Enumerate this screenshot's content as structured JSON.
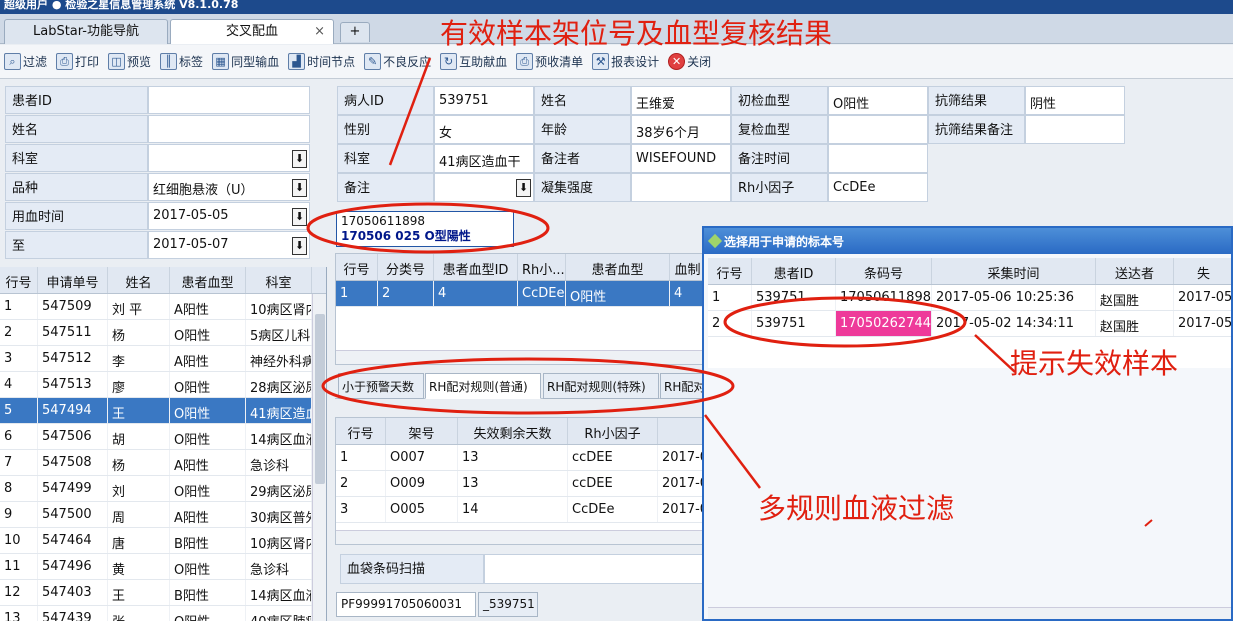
{
  "window": {
    "title": "超级用户  ●  检验之星信息管理系统  V8.1.0.78"
  },
  "tabs": [
    {
      "label": "LabStar-功能导航",
      "close": ""
    },
    {
      "label": "交叉配血",
      "close": "×"
    }
  ],
  "toolbar": [
    {
      "label": "过滤",
      "icon": "filter-icon"
    },
    {
      "label": "打印",
      "icon": "printer-icon"
    },
    {
      "label": "预览",
      "icon": "preview-icon"
    },
    {
      "label": "标签",
      "icon": "barcode-icon"
    },
    {
      "label": "同型输血",
      "icon": "grid-icon"
    },
    {
      "label": "时间节点",
      "icon": "chart-icon"
    },
    {
      "label": "不良反应",
      "icon": "edit-icon"
    },
    {
      "label": "互助献血",
      "icon": "refresh-icon"
    },
    {
      "label": "预收清单",
      "icon": "printer-icon"
    },
    {
      "label": "报表设计",
      "icon": "tools-icon"
    },
    {
      "label": "关闭",
      "icon": "close-icon"
    }
  ],
  "filter_form": [
    {
      "label": "患者ID",
      "value": ""
    },
    {
      "label": "姓名",
      "value": ""
    },
    {
      "label": "科室",
      "value": ""
    },
    {
      "label": "品种",
      "value": "红细胞悬液（U）"
    },
    {
      "label": "用血时间",
      "value": "2017-05-05"
    },
    {
      "label": "至",
      "value": "2017-05-07"
    }
  ],
  "left_grid": {
    "columns": [
      "行号",
      "申请单号",
      "姓名",
      "患者血型",
      "科室"
    ],
    "rows": [
      [
        "1",
        "547509",
        "刘  平",
        "A阳性",
        "10病区肾内"
      ],
      [
        "2",
        "547511",
        "杨",
        "O阳性",
        "5病区儿科"
      ],
      [
        "3",
        "547512",
        "李",
        "A阳性",
        "神经外科病"
      ],
      [
        "4",
        "547513",
        "廖",
        "O阳性",
        "28病区泌尿"
      ],
      [
        "5",
        "547494",
        "王",
        "O阳性",
        "41病区造血"
      ],
      [
        "6",
        "547506",
        "胡",
        "O阳性",
        "14病区血液"
      ],
      [
        "7",
        "547508",
        "杨",
        "A阳性",
        "急诊科"
      ],
      [
        "8",
        "547499",
        "刘",
        "O阳性",
        "29病区泌尿"
      ],
      [
        "9",
        "547500",
        "周",
        "A阳性",
        "30病区普外"
      ],
      [
        "10",
        "547464",
        "唐",
        "B阳性",
        "10病区肾内"
      ],
      [
        "11",
        "547496",
        "黄",
        "O阳性",
        "急诊科"
      ],
      [
        "12",
        "547403",
        "王",
        "B阳性",
        "14病区血液"
      ],
      [
        "13",
        "547439",
        "张",
        "O阳性",
        "40病区肺癌"
      ]
    ]
  },
  "patient": {
    "row1": [
      [
        "病人ID",
        "539751"
      ],
      [
        "姓名",
        "王维爱"
      ],
      [
        "初检血型",
        "O阳性"
      ],
      [
        "抗筛结果",
        "阴性"
      ]
    ],
    "row2": [
      [
        "性别",
        "女"
      ],
      [
        "年龄",
        "38岁6个月"
      ],
      [
        "复检血型",
        ""
      ],
      [
        "抗筛结果备注",
        ""
      ]
    ],
    "row3": [
      [
        "科室",
        "41病区造血干"
      ],
      [
        "备注者",
        "WISEFOUND"
      ],
      [
        "备注时间",
        ""
      ]
    ],
    "row4": [
      [
        "备注",
        ""
      ],
      [
        "凝集强度",
        ""
      ],
      [
        "Rh小因子",
        "CcDEe"
      ]
    ]
  },
  "info_box": {
    "line1": "17050611898",
    "line2": "170506 025  O型陽性"
  },
  "mid_grid": {
    "columns": [
      "行号",
      "分类号",
      "患者血型ID",
      "Rh小...",
      "患者血型",
      "血制"
    ],
    "rows": [
      [
        "1",
        "2",
        "4",
        "CcDEe",
        "O阳性",
        "4"
      ]
    ]
  },
  "rule_tabs": [
    "小于预警天数",
    "RH配对规则(普通)",
    "RH配对规则(特殊)",
    "RH配对"
  ],
  "bottom_grid": {
    "columns": [
      "行号",
      "架号",
      "失效剩余天数",
      "Rh小因子",
      ""
    ],
    "rows": [
      [
        "1",
        "O007",
        "13",
        "ccDEE",
        "2017-0"
      ],
      [
        "2",
        "O009",
        "13",
        "ccDEE",
        "2017-0"
      ],
      [
        "3",
        "O005",
        "14",
        "CcDEe",
        "2017-0"
      ]
    ]
  },
  "scan": {
    "label": "血袋条码扫描",
    "value": ""
  },
  "bottom_tabs": [
    "PF99991705060031",
    "_539751"
  ],
  "dialog": {
    "title": "选择用于申请的标本号",
    "columns": [
      "行号",
      "患者ID",
      "条码号",
      "采集时间",
      "送达者",
      "失"
    ],
    "rows": [
      [
        "1",
        "539751",
        "17050611898",
        "2017-05-06 10:25:36",
        "赵国胜",
        "2017-05"
      ],
      [
        "2",
        "539751",
        "17050262744",
        "2017-05-02 14:34:11",
        "赵国胜",
        "2017-05"
      ]
    ]
  },
  "annotations": {
    "top": "有效样本架位号及血型复核结果",
    "right": "提示失效样本",
    "bottom": "多规则血液过滤"
  },
  "colors": {
    "annotation": "#e02010",
    "selected_row": "#3a78c3",
    "expired_highlight": "#ee3a9a",
    "dialog_border": "#2a6ac4"
  }
}
